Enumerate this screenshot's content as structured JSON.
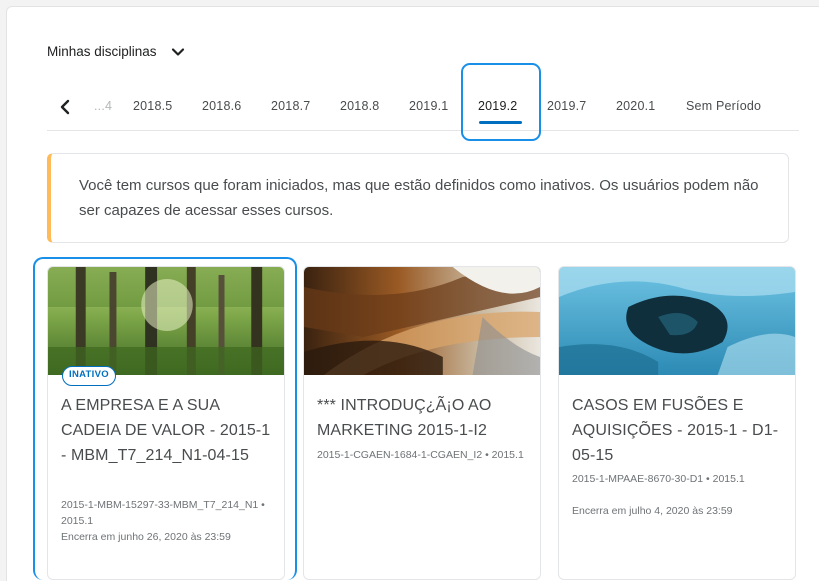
{
  "header": {
    "title": "Minhas disciplinas"
  },
  "tabs": [
    {
      "label": "...4",
      "state": "faded"
    },
    {
      "label": "2018.5"
    },
    {
      "label": "2018.6"
    },
    {
      "label": "2018.7"
    },
    {
      "label": "2018.8"
    },
    {
      "label": "2019.1"
    },
    {
      "label": "2019.2",
      "state": "active"
    },
    {
      "label": "2019.7"
    },
    {
      "label": "2020.1"
    },
    {
      "label": "Sem Período"
    }
  ],
  "alert": {
    "text": "Você tem cursos que foram iniciados, mas que estão definidos como inativos. Os usuários podem não ser capazes de acessar esses cursos."
  },
  "courses": [
    {
      "badge": "INATIVO",
      "title": "A EMPRESA E A SUA CADEIA DE VALOR - 2015-1 - MBM_T7_214_N1-04-15",
      "code": "2015-1-MBM-15297-33-MBM_T7_214_N1 • 2015.1",
      "ends": "Encerra em junho 26, 2020 às 23:59"
    },
    {
      "title": "*** INTRODUÇ¿Ã¡O AO MARKETING 2015-1-I2",
      "code": "2015-1-CGAEN-1684-1-CGAEN_I2 • 2015.1"
    },
    {
      "title": "CASOS EM FUSÕES E AQUISIÇÕES - 2015-1 - D1-05-15",
      "code": "2015-1-MPAAE-8670-30-D1 • 2015.1",
      "ends": "Encerra em julho 4, 2020 às 23:59"
    }
  ],
  "colors": {
    "accent": "#006fbf",
    "highlight": "#1a8fe8",
    "warning": "#ffba59"
  }
}
